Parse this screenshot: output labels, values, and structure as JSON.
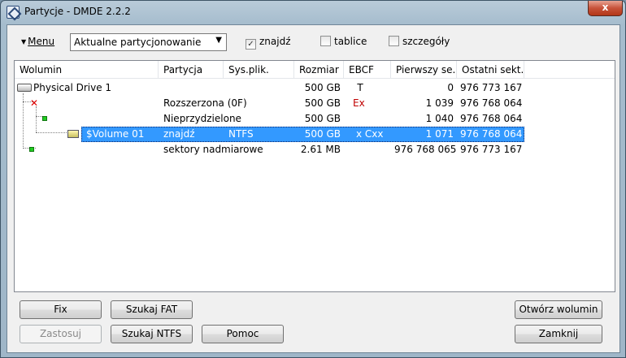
{
  "window": {
    "title": "Partycje - DMDE 2.2.2",
    "close": "x"
  },
  "toolbar": {
    "menu_label": "Menu",
    "view_select": "Aktualne partycjonowanie",
    "found_checkbox": {
      "label": "znajdź",
      "checked": true
    },
    "tables_checkbox": {
      "label": "tablice",
      "checked": false
    },
    "details_checkbox": {
      "label": "szczegóły",
      "checked": false
    }
  },
  "table": {
    "columns": [
      "Wolumin",
      "Partycja",
      "Sys.plik.",
      "Rozmiar",
      "EBCF",
      "Pierwszy se...",
      "Ostatni sekt..."
    ],
    "rows": [
      {
        "volume": "Physical Drive 1",
        "partition": "",
        "fs": "",
        "size": "500 GB",
        "ebcf": "T",
        "first": "0",
        "last": "976 773 167"
      },
      {
        "volume": "",
        "partition": "Rozszerzona   (0F)",
        "fs": "",
        "size": "500 GB",
        "ebcf": "Ex",
        "first": "1 039",
        "last": "976 768 064"
      },
      {
        "volume": "",
        "partition": "Nieprzydzielone",
        "fs": "",
        "size": "500 GB",
        "ebcf": "",
        "first": "1 040",
        "last": "976 768 064"
      },
      {
        "volume": "$Volume 01",
        "partition": "znajdź",
        "fs": "NTFS",
        "size": "500 GB",
        "ebcf": "x Cxx",
        "first": "1 071",
        "last": "976 768 064"
      },
      {
        "volume": "",
        "partition": "sektory nadmiarowe",
        "fs": "",
        "size": "2.61 MB",
        "ebcf": "",
        "first": "976 768 065",
        "last": "976 773 167"
      }
    ]
  },
  "buttons": {
    "fix": "Fix",
    "apply": "Zastosuj",
    "search_fat": "Szukaj FAT",
    "search_ntfs": "Szukaj NTFS",
    "help": "Pomoc",
    "open_volume": "Otwórz wolumin",
    "close": "Zamknij"
  }
}
